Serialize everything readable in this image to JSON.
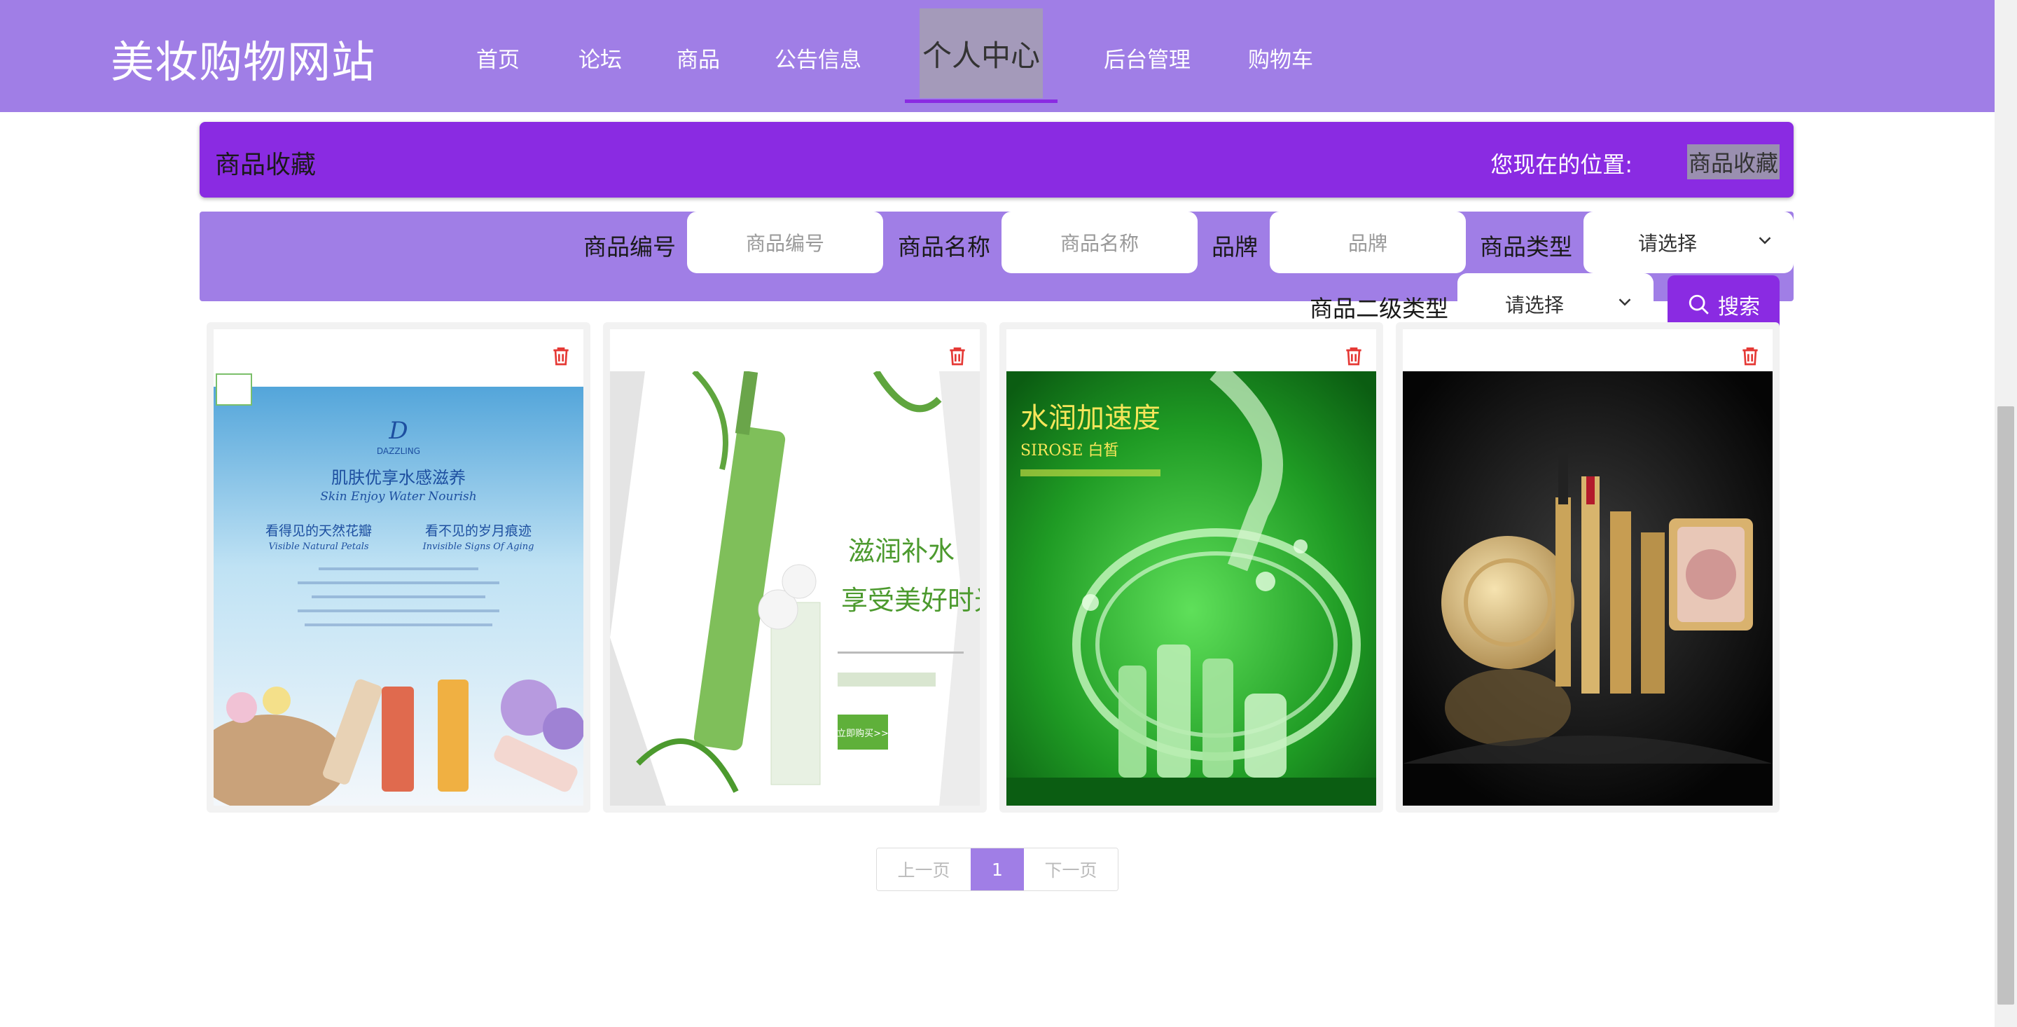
{
  "header": {
    "site_title": "美妆购物网站",
    "nav": [
      {
        "label": "首页"
      },
      {
        "label": "论坛"
      },
      {
        "label": "商品"
      },
      {
        "label": "公告信息"
      },
      {
        "label": "个人中心"
      },
      {
        "label": "后台管理"
      },
      {
        "label": "购物车"
      }
    ]
  },
  "breadcrumb": {
    "title": "商品收藏",
    "location_label": "您现在的位置:",
    "current": "商品收藏"
  },
  "search": {
    "code_label": "商品编号",
    "code_placeholder": "商品编号",
    "name_label": "商品名称",
    "name_placeholder": "商品名称",
    "brand_label": "品牌",
    "brand_placeholder": "品牌",
    "type_label": "商品类型",
    "type_value": "请选择",
    "subtype_label": "商品二级类型",
    "subtype_value": "请选择",
    "button_label": "搜索"
  },
  "favorites": [
    {
      "image": "dazzling-skin-poster",
      "image_text": [
        "DAZZLING",
        "肌肤优享水感滋养",
        "Skin Enjoy Water Nourish",
        "看得见的天然花瓣",
        "看不见的岁月痕迹",
        "Visible Natural Petals",
        "Invisible Signs Of Aging"
      ]
    },
    {
      "image": "green-hydration-poster",
      "image_text": [
        "滋润补水",
        "享受美好时光",
        "立即购买>>"
      ]
    },
    {
      "image": "green-water-splash-poster",
      "image_text": [
        "水润加速度",
        "SIROSE 白皙"
      ]
    },
    {
      "image": "gold-cosmetics-set",
      "image_text": []
    }
  ],
  "pagination": {
    "prev": "上一页",
    "current": "1",
    "next": "下一页"
  },
  "colors": {
    "header_bg": "#a07ee6",
    "accent": "#8a2be2",
    "delete_icon": "#e53935"
  }
}
